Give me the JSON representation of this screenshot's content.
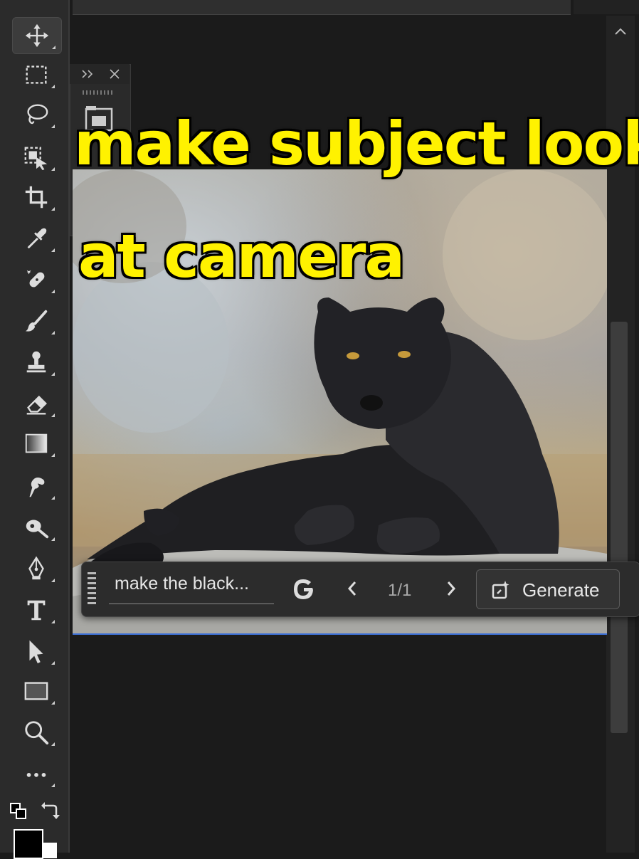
{
  "caption": {
    "line1": "make subject look",
    "line2": "at camera"
  },
  "taskbar": {
    "prompt_text": "make the black...",
    "variation_counter": "1/1",
    "generate_label": "Generate"
  },
  "toolbar": {
    "tools": [
      {
        "name": "move-tool"
      },
      {
        "name": "rectangular-marquee-tool"
      },
      {
        "name": "lasso-tool"
      },
      {
        "name": "object-selection-tool"
      },
      {
        "name": "crop-tool"
      },
      {
        "name": "eyedropper-tool"
      },
      {
        "name": "spot-healing-brush-tool"
      },
      {
        "name": "brush-tool"
      },
      {
        "name": "clone-stamp-tool"
      },
      {
        "name": "eraser-tool"
      },
      {
        "name": "gradient-tool"
      },
      {
        "name": "smudge-tool"
      },
      {
        "name": "dodge-tool"
      },
      {
        "name": "pen-tool"
      },
      {
        "name": "type-tool"
      },
      {
        "name": "path-selection-tool"
      },
      {
        "name": "rectangle-tool"
      },
      {
        "name": "zoom-tool"
      },
      {
        "name": "edit-toolbar"
      }
    ],
    "foreground_color": "#000000",
    "background_color": "#ffffff"
  },
  "colors": {
    "caption_fill": "#fff200",
    "canvas_selection_edge": "#3b6fd6",
    "ui_dark": "#2b2b2b"
  }
}
